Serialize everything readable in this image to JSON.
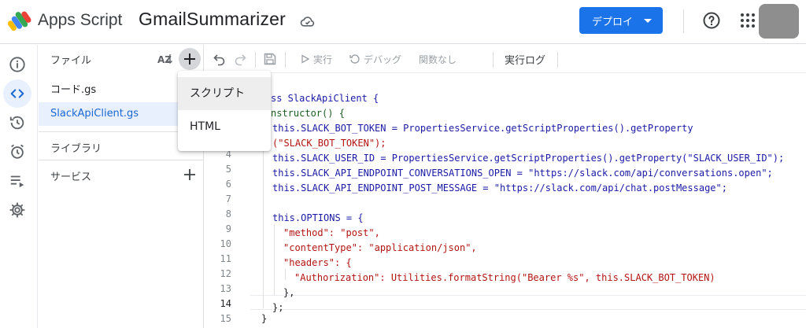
{
  "app": {
    "brand": "Apps Script",
    "project_name": "GmailSummarizer"
  },
  "header": {
    "deploy_label": "デプロイ"
  },
  "rail": {
    "items": [
      {
        "icon": "info-icon"
      },
      {
        "icon": "code-icon",
        "active": true
      },
      {
        "icon": "history-icon"
      },
      {
        "icon": "alarm-icon"
      },
      {
        "icon": "executions-icon"
      },
      {
        "icon": "gear-icon"
      }
    ]
  },
  "files": {
    "title": "ファイル",
    "sort_label": "AZ",
    "items": [
      "コード.gs",
      "SlackApiClient.gs"
    ],
    "selected": "SlackApiClient.gs",
    "libraries_label": "ライブラリ",
    "services_label": "サービス"
  },
  "toolbar": {
    "run_label": "実行",
    "debug_label": "デバッグ",
    "function_label": "関数なし",
    "log_label": "実行ログ"
  },
  "menu": {
    "items": [
      "スクリプト",
      "HTML"
    ]
  },
  "editor": {
    "line_numbers": [
      "4",
      "5",
      "6",
      "7",
      "8",
      "9",
      "10",
      "11",
      "12",
      "13",
      "14",
      "15"
    ],
    "current_line": "14",
    "lines": [
      "ss SlackApiClient {",
      "nstructor() {",
      "this.SLACK_BOT_TOKEN = PropertiesService.getScriptProperties().getProperty",
      "(\"SLACK_BOT_TOKEN\");",
      "this.SLACK_USER_ID = PropertiesService.getScriptProperties().getProperty(\"SLACK_USER_ID\");",
      "this.SLACK_API_ENDPOINT_CONVERSATIONS_OPEN = \"https://slack.com/api/conversations.open\";",
      "this.SLACK_API_ENDPOINT_POST_MESSAGE = \"https://slack.com/api/chat.postMessage\";",
      "",
      "this.OPTIONS = {",
      "\"method\": \"post\",",
      "\"contentType\": \"application/json\",",
      "\"headers\": {",
      "\"Authorization\": Utilities.formatString(\"Bearer %s\", this.SLACK_BOT_TOKEN)",
      "},",
      "};",
      "}"
    ]
  }
}
